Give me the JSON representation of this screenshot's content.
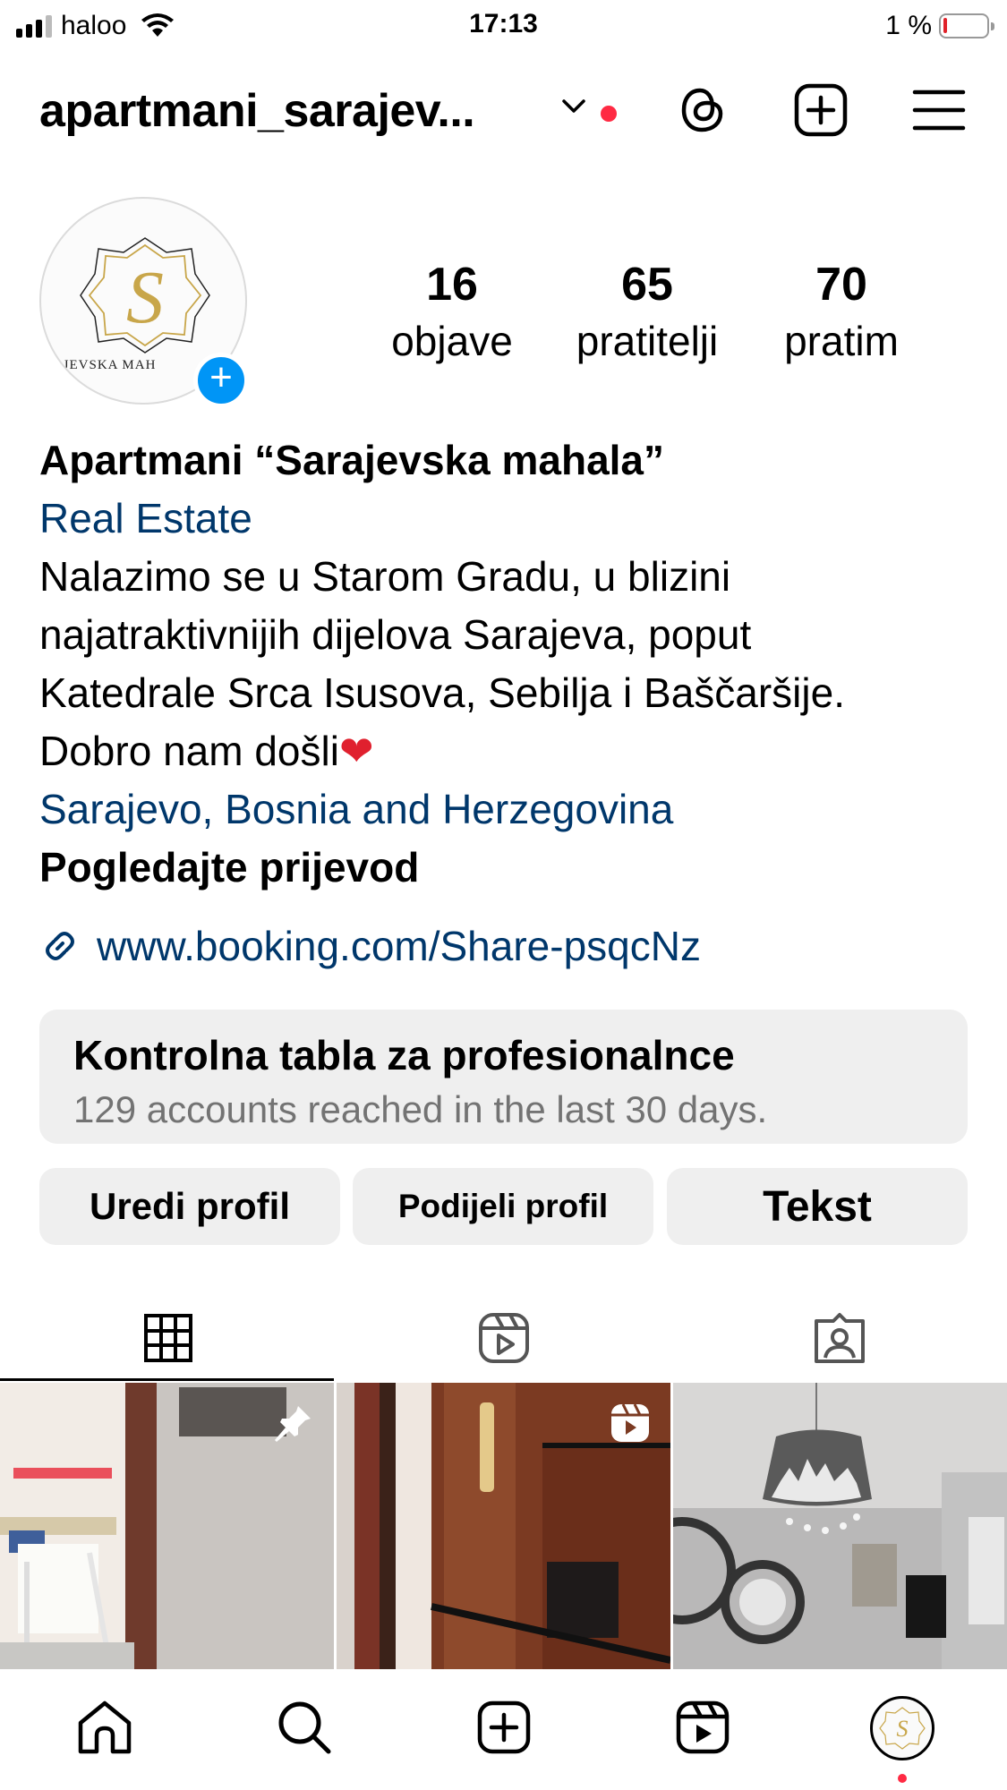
{
  "status_bar": {
    "carrier": "haloo",
    "time": "17:13",
    "battery_percent": "1 %",
    "battery_level": 0.01
  },
  "header": {
    "username": "apartmani_sarajev...",
    "icons": [
      "chevron-down-icon",
      "threads-icon",
      "create-icon",
      "menu-icon"
    ]
  },
  "profile": {
    "avatar_logo_letter": "S",
    "avatar_logo_text": "ARAJEVSKA MAH",
    "stats": [
      {
        "value": "16",
        "label": "objave"
      },
      {
        "value": "65",
        "label": "pratitelji"
      },
      {
        "value": "70",
        "label": "pratim"
      }
    ],
    "display_name": "Apartmani “Sarajevska mahala”",
    "category": "Real Estate",
    "bio_lines": [
      "Nalazimo se u Starom Gradu, u blizini",
      "najatraktivnijih dijelova Sarajeva, poput",
      "Katedrale Srca Isusova, Sebilja i Baščaršije."
    ],
    "bio_last": "Dobro nam došli",
    "bio_emoji": "❤",
    "location": "Sarajevo, Bosnia and Herzegovina",
    "translate": "Pogledajte prijevod",
    "link": "www.booking.com/Share-psqcNz"
  },
  "dashboard": {
    "title": "Kontrolna tabla za profesionalnce",
    "subtitle": "129 accounts reached in the last 30 days."
  },
  "buttons": {
    "edit": "Uredi profil",
    "share": "Podijeli profil",
    "text": "Tekst"
  },
  "tabs": [
    "grid-icon",
    "reels-icon",
    "tagged-icon"
  ],
  "grid": [
    {
      "badge": "pin-icon"
    },
    {
      "badge": "reels-icon"
    },
    {
      "badge": ""
    }
  ],
  "bottom_nav": [
    "home-icon",
    "search-icon",
    "create-icon",
    "reels-icon",
    "profile-avatar"
  ],
  "colors": {
    "link": "#00376b",
    "accent": "#0095f6",
    "notification": "#ff2a43",
    "button_bg": "#efefef",
    "muted": "#737373"
  }
}
